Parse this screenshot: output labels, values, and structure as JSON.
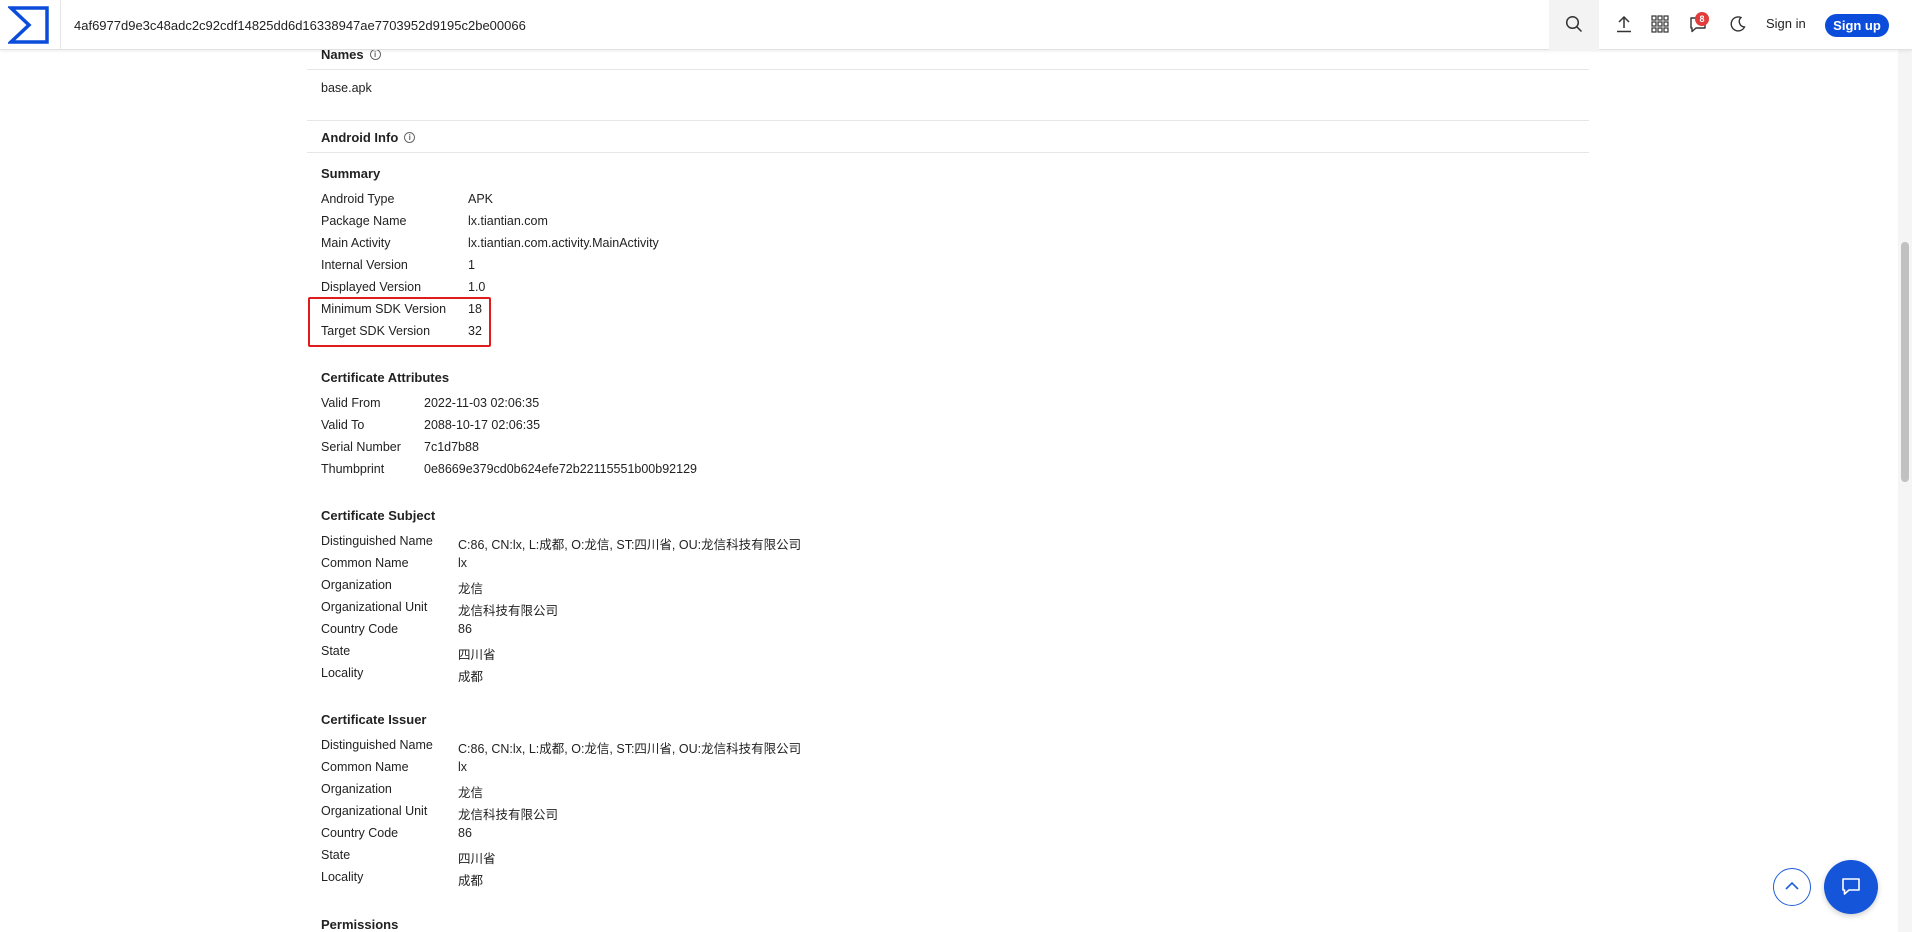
{
  "header": {
    "search_value": "4af6977d9e3c48adc2c92cdf14825dd6d16338947ae7703952d9195c2be00066",
    "notification_count": "8",
    "signin_label": "Sign in",
    "signup_label": "Sign up",
    "brand_color": "#0b4dda"
  },
  "names": {
    "title": "Names",
    "value": "base.apk"
  },
  "android_info": {
    "title": "Android Info",
    "summary": {
      "title": "Summary",
      "rows": [
        {
          "key": "Android Type",
          "value": "APK"
        },
        {
          "key": "Package Name",
          "value": "lx.tiantian.com"
        },
        {
          "key": "Main Activity",
          "value": "lx.tiantian.com.activity.MainActivity"
        },
        {
          "key": "Internal Version",
          "value": "1"
        },
        {
          "key": "Displayed Version",
          "value": "1.0"
        },
        {
          "key": "Minimum SDK Version",
          "value": "18"
        },
        {
          "key": "Target SDK Version",
          "value": "32"
        }
      ]
    },
    "cert_attributes": {
      "title": "Certificate Attributes",
      "rows": [
        {
          "key": "Valid From",
          "value": "2022-11-03 02:06:35"
        },
        {
          "key": "Valid To",
          "value": "2088-10-17 02:06:35"
        },
        {
          "key": "Serial Number",
          "value": "7c1d7b88"
        },
        {
          "key": "Thumbprint",
          "value": "0e8669e379cd0b624efe72b22115551b00b92129"
        }
      ]
    },
    "cert_subject": {
      "title": "Certificate Subject",
      "rows": [
        {
          "key": "Distinguished Name",
          "value": "C:86, CN:lx, L:成都, O:龙信, ST:四川省, OU:龙信科技有限公司"
        },
        {
          "key": "Common Name",
          "value": "lx"
        },
        {
          "key": "Organization",
          "value": "龙信"
        },
        {
          "key": "Organizational Unit",
          "value": "龙信科技有限公司"
        },
        {
          "key": "Country Code",
          "value": "86"
        },
        {
          "key": "State",
          "value": "四川省"
        },
        {
          "key": "Locality",
          "value": "成都"
        }
      ]
    },
    "cert_issuer": {
      "title": "Certificate Issuer",
      "rows": [
        {
          "key": "Distinguished Name",
          "value": "C:86, CN:lx, L:成都, O:龙信, ST:四川省, OU:龙信科技有限公司"
        },
        {
          "key": "Common Name",
          "value": "lx"
        },
        {
          "key": "Organization",
          "value": "龙信"
        },
        {
          "key": "Organizational Unit",
          "value": "龙信科技有限公司"
        },
        {
          "key": "Country Code",
          "value": "86"
        },
        {
          "key": "State",
          "value": "四川省"
        },
        {
          "key": "Locality",
          "value": "成都"
        }
      ]
    },
    "permissions_title": "Permissions"
  },
  "icons": {
    "logo": "virustotal-logo-icon",
    "search": "search-icon",
    "upload": "upload-icon",
    "apps": "apps-grid-icon",
    "notifications": "chat-notification-icon",
    "theme": "moon-icon",
    "to_top": "chevron-up-icon",
    "chat": "chat-bubble-icon"
  }
}
